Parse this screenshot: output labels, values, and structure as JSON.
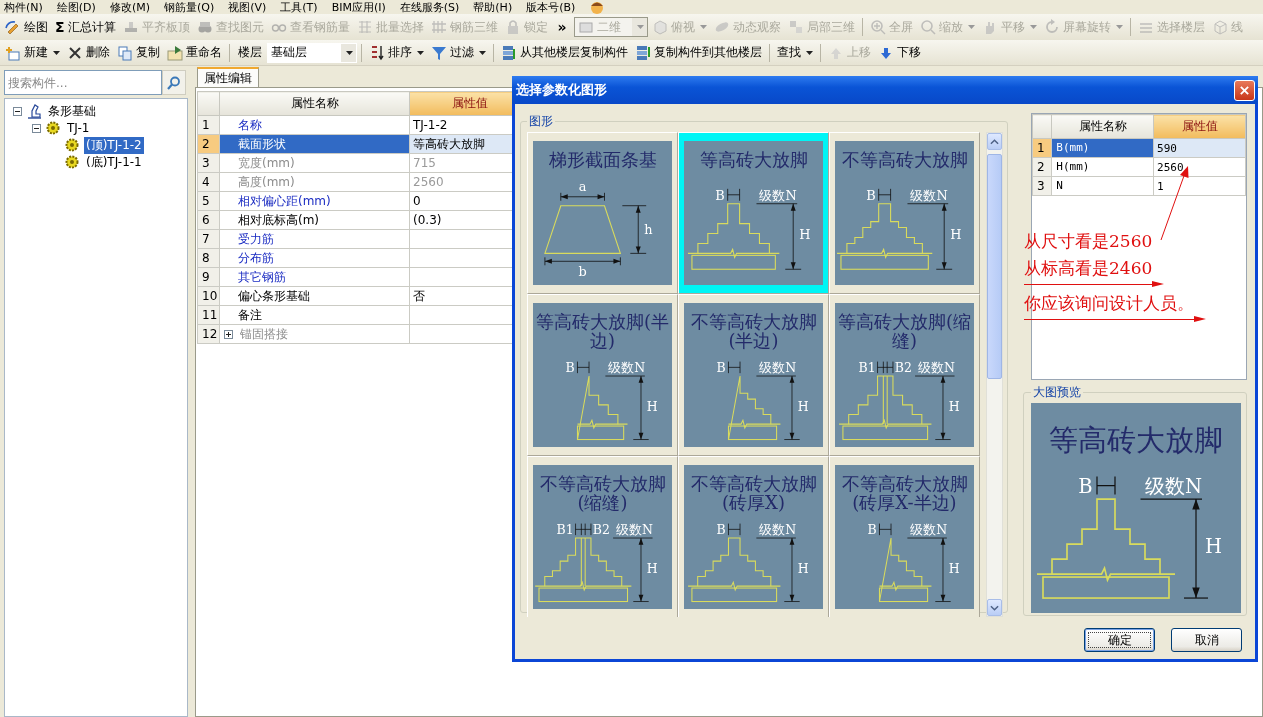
{
  "menu_bar": [
    "构件(N)",
    "绘图(D)",
    "修改(M)",
    "钢筋量(Q)",
    "视图(V)",
    "工具(T)",
    "BIM应用(I)",
    "在线服务(S)",
    "帮助(H)",
    "版本号(B)"
  ],
  "toolbar_1": [
    {
      "kind": "button",
      "label": "绘图",
      "disabled": false,
      "dropdown": false
    },
    {
      "kind": "button",
      "glyph": "Σ",
      "label": "汇总计算",
      "disabled": false,
      "dropdown": false
    },
    {
      "kind": "button",
      "label": "平齐板顶",
      "disabled": true,
      "dropdown": false
    },
    {
      "kind": "button",
      "label": "查找图元",
      "disabled": true,
      "dropdown": false
    },
    {
      "kind": "button",
      "label": "查看钢筋量",
      "disabled": true,
      "dropdown": false
    },
    {
      "kind": "button",
      "label": "批量选择",
      "disabled": true,
      "dropdown": false
    },
    {
      "kind": "button",
      "label": "钢筋三维",
      "disabled": true,
      "dropdown": false
    },
    {
      "kind": "button",
      "label": "锁定",
      "disabled": true,
      "dropdown": false
    },
    {
      "kind": "overflow",
      "glyph": "»"
    },
    {
      "kind": "combo",
      "value": "二维",
      "disabled": true
    },
    {
      "kind": "button",
      "label": "俯视",
      "disabled": true,
      "dropdown": true
    },
    {
      "kind": "button",
      "label": "动态观察",
      "disabled": true,
      "dropdown": false
    },
    {
      "kind": "button",
      "label": "局部三维",
      "disabled": true,
      "dropdown": false
    },
    {
      "kind": "button",
      "label": "全屏",
      "disabled": true,
      "dropdown": false
    },
    {
      "kind": "button",
      "label": "缩放",
      "disabled": true,
      "dropdown": true
    },
    {
      "kind": "button",
      "label": "平移",
      "disabled": true,
      "dropdown": true
    },
    {
      "kind": "button",
      "label": "屏幕旋转",
      "disabled": true,
      "dropdown": true
    },
    {
      "kind": "button",
      "label": "选择楼层",
      "disabled": true,
      "dropdown": false
    },
    {
      "kind": "button",
      "label": "线",
      "disabled": true,
      "dropdown": false
    }
  ],
  "toolbar_2": [
    {
      "kind": "button",
      "label": "新建",
      "disabled": false,
      "dropdown": true
    },
    {
      "kind": "button",
      "label": "删除",
      "disabled": false,
      "dropdown": false
    },
    {
      "kind": "button",
      "label": "复制",
      "disabled": false,
      "dropdown": false
    },
    {
      "kind": "button",
      "label": "重命名",
      "disabled": false,
      "dropdown": false
    },
    {
      "kind": "label",
      "label": "楼层"
    },
    {
      "kind": "combo",
      "value": "基础层",
      "disabled": false
    },
    {
      "kind": "button",
      "label": "排序",
      "disabled": false,
      "dropdown": true
    },
    {
      "kind": "button",
      "label": "过滤",
      "disabled": false,
      "dropdown": true
    },
    {
      "kind": "button",
      "label": "从其他楼层复制构件",
      "disabled": false,
      "dropdown": false
    },
    {
      "kind": "button",
      "label": "复制构件到其他楼层",
      "disabled": false,
      "dropdown": false
    },
    {
      "kind": "button",
      "label": "查找",
      "disabled": false,
      "dropdown": true
    },
    {
      "kind": "button",
      "label": "上移",
      "disabled": true,
      "dropdown": false
    },
    {
      "kind": "button",
      "label": "下移",
      "disabled": false,
      "dropdown": false
    }
  ],
  "search": {
    "placeholder": "搜索构件..."
  },
  "tree": [
    {
      "label": "条形基础",
      "expanded": true,
      "selected": false,
      "children": [
        {
          "label": "TJ-1",
          "expanded": true,
          "selected": false,
          "children": [
            {
              "label": "(顶)TJ-1-2",
              "selected": true
            },
            {
              "label": "(底)TJ-1-1",
              "selected": false
            }
          ]
        }
      ]
    }
  ],
  "property_panel": {
    "tab": "属性编辑",
    "columns": [
      "属性名称",
      "属性值"
    ],
    "rows": [
      {
        "number": "1",
        "name": "名称",
        "value": "TJ-1-2",
        "kind": "public",
        "selected": false
      },
      {
        "number": "2",
        "name": "截面形状",
        "value": "等高砖大放脚",
        "kind": "public",
        "selected": true
      },
      {
        "number": "3",
        "name": "宽度(mm)",
        "value": "715",
        "kind": "readonly",
        "selected": false
      },
      {
        "number": "4",
        "name": "高度(mm)",
        "value": "2560",
        "kind": "readonly",
        "selected": false
      },
      {
        "number": "5",
        "name": "相对偏心距(mm)",
        "value": "0",
        "kind": "public",
        "selected": false
      },
      {
        "number": "6",
        "name": "相对底标高(m)",
        "value": "(0.3)",
        "kind": "private",
        "selected": false
      },
      {
        "number": "7",
        "name": "受力筋",
        "kind": "public",
        "selected": false
      },
      {
        "number": "8",
        "name": "分布筋",
        "kind": "public",
        "selected": false
      },
      {
        "number": "9",
        "name": "其它钢筋",
        "kind": "public",
        "selected": false
      },
      {
        "number": "10",
        "name": "偏心条形基础",
        "value": "否",
        "kind": "private",
        "selected": false
      },
      {
        "number": "11",
        "name": "备注",
        "kind": "private",
        "selected": false
      },
      {
        "number": "12",
        "name": "锚固搭接",
        "kind": "readonly",
        "selected": false,
        "expanded": false
      }
    ]
  },
  "dialog": {
    "title": "选择参数化图形",
    "gallery": {
      "label": "图形",
      "tiles": [
        {
          "title": "梯形截面条基",
          "kind": "trapezoid",
          "labels": [
            "a",
            "h",
            "b"
          ],
          "selected": false
        },
        {
          "title": "等高砖大放脚",
          "kind": "equal",
          "labels": [
            "B",
            "级数N",
            "H"
          ],
          "selected": true
        },
        {
          "title": "不等高砖大放脚",
          "kind": "unequal",
          "labels": [
            "B",
            "级数N",
            "H"
          ],
          "selected": false
        },
        {
          "title": "等高砖大放脚(半边)",
          "kind": "equal-half",
          "labels": [
            "B",
            "级数N",
            "H"
          ],
          "selected": false
        },
        {
          "title": "不等高砖大放脚(半边)",
          "kind": "unequal-half",
          "labels": [
            "B",
            "级数N",
            "H"
          ],
          "selected": false
        },
        {
          "title": "等高砖大放脚(缩缝)",
          "kind": "equal-joint",
          "labels": [
            "B1",
            "B2",
            "级数N",
            "H"
          ],
          "selected": false
        },
        {
          "title": "不等高砖大放脚(缩缝)",
          "kind": "unequal-joint",
          "labels": [
            "B1",
            "B2",
            "级数N",
            "H"
          ],
          "selected": false
        },
        {
          "title": "不等高砖大放脚(砖厚X)",
          "kind": "unequal",
          "labels": [
            "B",
            "级数N",
            "H"
          ],
          "selected": false
        },
        {
          "title": "不等高砖大放脚(砖厚X-半边)",
          "kind": "unequal-half",
          "labels": [
            "B",
            "级数N",
            "H"
          ],
          "selected": false
        }
      ]
    },
    "parameters": {
      "columns": [
        "属性名称",
        "属性值"
      ],
      "rows": [
        {
          "number": "1",
          "name": "B(mm)",
          "value": "590",
          "selected": true
        },
        {
          "number": "2",
          "name": "H(mm)",
          "value": "2560",
          "selected": false
        },
        {
          "number": "3",
          "name": "N",
          "value": "1",
          "selected": false
        }
      ]
    },
    "annotations": [
      {
        "text": "从尺寸看是2560",
        "kind": "pointer"
      },
      {
        "text": "从标高看是2460",
        "kind": "underline"
      },
      {
        "text": "你应该询问设计人员。",
        "kind": "underline"
      }
    ],
    "preview": {
      "label": "大图预览",
      "title": "等高砖大放脚",
      "kind": "equal",
      "labels": [
        "B",
        "级数N",
        "H"
      ]
    },
    "buttons": [
      {
        "label": "确定",
        "default": true
      },
      {
        "label": "取消",
        "default": false
      }
    ]
  }
}
